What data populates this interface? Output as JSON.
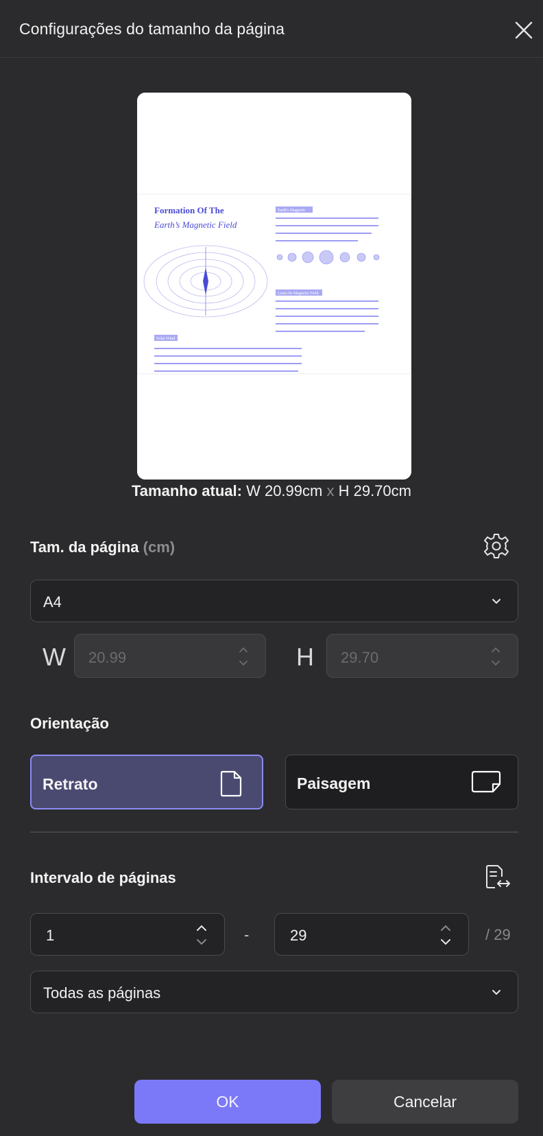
{
  "dialog": {
    "title": "Configurações do tamanho da página"
  },
  "preview": {
    "doc_title_line1": "Formation Of The",
    "doc_title_line2": "Earth’s Magnetic Field",
    "heading_1": "Earth's Magnetic",
    "heading_2": "Loses Its Magnetic Field",
    "heading_3": "Solar Wind",
    "colors": {
      "title": "#4a4ad6",
      "accent": "#8c8cf4",
      "text": "#5a5ae0"
    }
  },
  "current_size": {
    "label": "Tamanho atual:",
    "width_text": "W 20.99cm",
    "sep": "x",
    "height_text": "H 29.70cm"
  },
  "page_size": {
    "label": "Tam. da página",
    "unit": "(cm)",
    "selected": "A4",
    "w_label": "W",
    "w_value": "20.99",
    "h_label": "H",
    "h_value": "29.70"
  },
  "orientation": {
    "label": "Orientação",
    "options": [
      {
        "label": "Retrato",
        "selected": true
      },
      {
        "label": "Paisagem",
        "selected": false
      }
    ]
  },
  "page_range": {
    "label": "Intervalo de páginas",
    "from": "1",
    "dash": "-",
    "to": "29",
    "total": "/ 29",
    "subset": "Todas as páginas"
  },
  "buttons": {
    "ok": "OK",
    "cancel": "Cancelar"
  },
  "theme": {
    "background": "#2b2b2d",
    "primary": "#7b79f7",
    "selected_bg": "#4a4a71",
    "selected_border": "#8c8cf4"
  }
}
